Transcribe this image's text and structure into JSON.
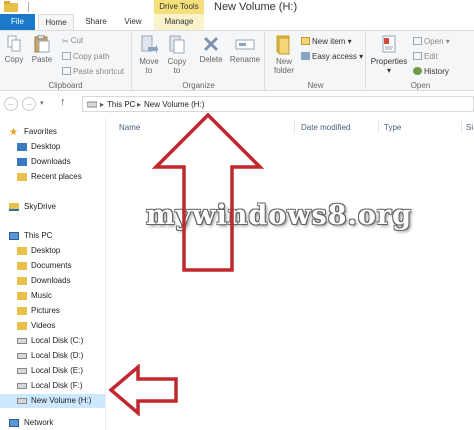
{
  "window": {
    "title": "New Volume (H:)",
    "context_tab_header": "Drive Tools"
  },
  "tabs": [
    {
      "label": "File"
    },
    {
      "label": "Home"
    },
    {
      "label": "Share"
    },
    {
      "label": "View"
    },
    {
      "label": "Manage"
    }
  ],
  "ribbon": {
    "clipboard": {
      "label": "Clipboard",
      "copy": "Copy",
      "paste": "Paste",
      "cut": "Cut",
      "copy_path": "Copy path",
      "paste_shortcut": "Paste shortcut"
    },
    "organize": {
      "label": "Organize",
      "move_to_1": "Move",
      "move_to_2": "to",
      "copy_to_1": "Copy",
      "copy_to_2": "to",
      "delete": "Delete",
      "rename": "Rename"
    },
    "new": {
      "label": "New",
      "new_folder_1": "New",
      "new_folder_2": "folder",
      "new_item": "New item",
      "easy_access": "Easy access"
    },
    "open": {
      "label": "Open",
      "properties": "Properties",
      "open": "Open",
      "edit": "Edit",
      "history": "History"
    }
  },
  "address": {
    "crumbs": [
      "This PC",
      "New Volume (H:)"
    ]
  },
  "nav": {
    "favorites": "Favorites",
    "desktop_fav": "Desktop",
    "downloads_fav": "Downloads",
    "recent": "Recent places",
    "skydrive": "SkyDrive",
    "this_pc": "This PC",
    "desktop": "Desktop",
    "documents": "Documents",
    "downloads": "Downloads",
    "music": "Music",
    "pictures": "Pictures",
    "videos": "Videos",
    "disk_c": "Local Disk (C:)",
    "disk_d": "Local Disk (D:)",
    "disk_e": "Local Disk (E:)",
    "disk_f": "Local Disk (F:)",
    "vol_h": "New Volume (H:)",
    "network": "Network"
  },
  "columns": {
    "name": "Name",
    "date": "Date modified",
    "type": "Type",
    "size": "Si"
  },
  "watermark": "mywindows8.org",
  "colors": {
    "file_tab": "#1979ca",
    "drive_tools": "#f4df7a",
    "arrow": "#c0282d",
    "selected": "#cce8ff"
  }
}
